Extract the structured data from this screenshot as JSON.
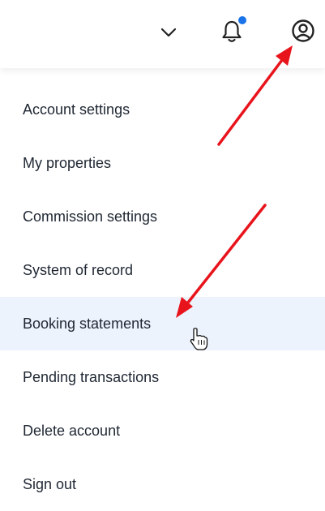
{
  "header": {
    "icons": {
      "dropdown": "chevron-down-icon",
      "notifications": "bell-icon",
      "account": "user-circle-icon"
    },
    "notification_dot_color": "#1a73e8"
  },
  "menu": {
    "items": [
      {
        "label": "Account settings"
      },
      {
        "label": "My properties"
      },
      {
        "label": "Commission settings"
      },
      {
        "label": "System of record"
      },
      {
        "label": "Booking statements",
        "state": "hover"
      },
      {
        "label": "Pending transactions"
      },
      {
        "label": "Delete account"
      },
      {
        "label": "Sign out"
      }
    ],
    "hover_background": "#edf3fc"
  },
  "annotations": {
    "arrow_color": "#e8141c",
    "cursor": "hand-pointer-icon"
  }
}
